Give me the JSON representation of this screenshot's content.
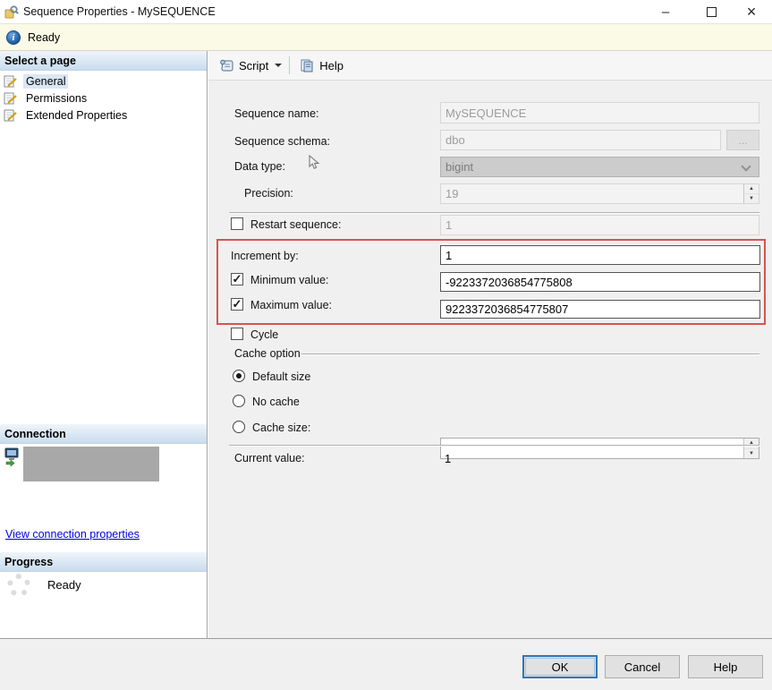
{
  "window": {
    "title": "Sequence Properties - MySEQUENCE"
  },
  "status_strip": {
    "text": "Ready"
  },
  "toolbar": {
    "script_label": "Script",
    "help_label": "Help"
  },
  "sidebar": {
    "select_page": {
      "header": "Select a page",
      "items": [
        {
          "label": "General",
          "selected": true
        },
        {
          "label": "Permissions",
          "selected": false
        },
        {
          "label": "Extended Properties",
          "selected": false
        }
      ]
    },
    "connection": {
      "header": "Connection",
      "link": "View connection properties"
    },
    "progress": {
      "header": "Progress",
      "status": "Ready"
    }
  },
  "form": {
    "sequence_name": {
      "label": "Sequence name:",
      "value": "MySEQUENCE",
      "disabled": true
    },
    "sequence_schema": {
      "label": "Sequence schema:",
      "value": "dbo",
      "browse_label": "...",
      "disabled": true
    },
    "data_type": {
      "label": "Data type:",
      "value": "bigint",
      "disabled": true
    },
    "precision": {
      "label": "Precision:",
      "value": "19",
      "disabled": true
    },
    "restart_sequence": {
      "label": "Restart sequence:",
      "value": "1",
      "checked": false,
      "disabled": true
    },
    "increment_by": {
      "label": "Increment by:",
      "value": "1"
    },
    "minimum_value": {
      "label": "Minimum value:",
      "value": "-9223372036854775808",
      "checked": true
    },
    "maximum_value": {
      "label": "Maximum value:",
      "value": "9223372036854775807",
      "checked": true
    },
    "cycle": {
      "label": "Cycle",
      "checked": false
    },
    "cache_option": {
      "group_label": "Cache option",
      "options": [
        {
          "label": "Default size",
          "selected": true
        },
        {
          "label": "No cache",
          "selected": false
        },
        {
          "label": "Cache size:",
          "selected": false,
          "value": ""
        }
      ]
    },
    "current_value": {
      "label": "Current value:",
      "value": "1"
    }
  },
  "footer": {
    "ok": "OK",
    "cancel": "Cancel",
    "help": "Help"
  },
  "icons": {
    "info": "i",
    "check": "✓",
    "spin_up": "▲",
    "spin_down": "▼",
    "minimize": "–",
    "close": "×"
  },
  "colors": {
    "highlight_border": "#D9534F",
    "link": "#0000E0",
    "default_button_border": "#3074B8"
  }
}
